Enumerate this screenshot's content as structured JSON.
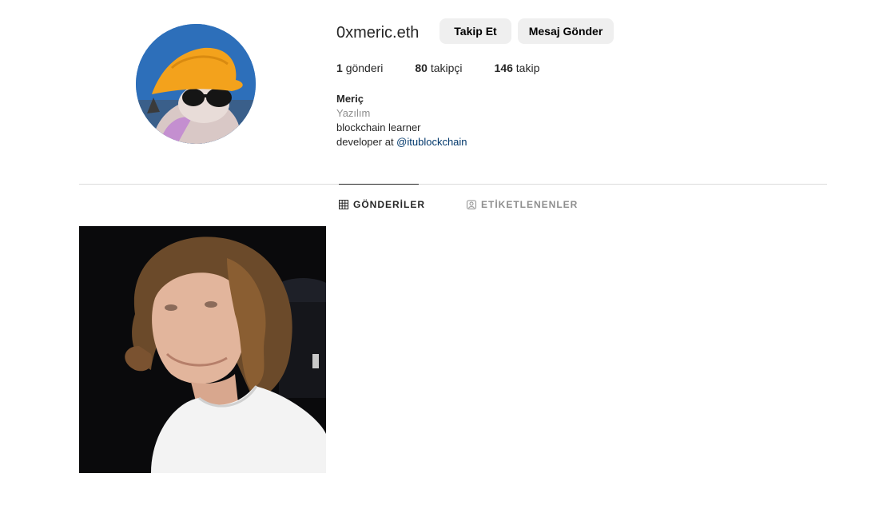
{
  "profile": {
    "username": "0xmeric.eth",
    "follow_label": "Takip Et",
    "message_label": "Mesaj Gönder",
    "stats": {
      "posts_count": "1",
      "posts_label": "gönderi",
      "followers_count": "80",
      "followers_label": "takipçi",
      "following_count": "146",
      "following_label": "takip"
    },
    "bio": {
      "name": "Meriç",
      "category": "Yazılım",
      "line1": "blockchain learner",
      "line2_prefix": "developer at ",
      "line2_link": "@itublockchain"
    }
  },
  "tabs": {
    "posts_label": "GÖNDERİLER",
    "tagged_label": "ETİKETLENENLER",
    "active": "posts"
  },
  "colors": {
    "button_bg": "#efefef",
    "link": "#00376b",
    "muted": "#8e8e8e",
    "divider": "#dbdbdb"
  },
  "icons": {
    "posts_tab": "grid-icon",
    "tagged_tab": "tagged-person-icon"
  },
  "posts": [
    {
      "type": "photo"
    }
  ]
}
